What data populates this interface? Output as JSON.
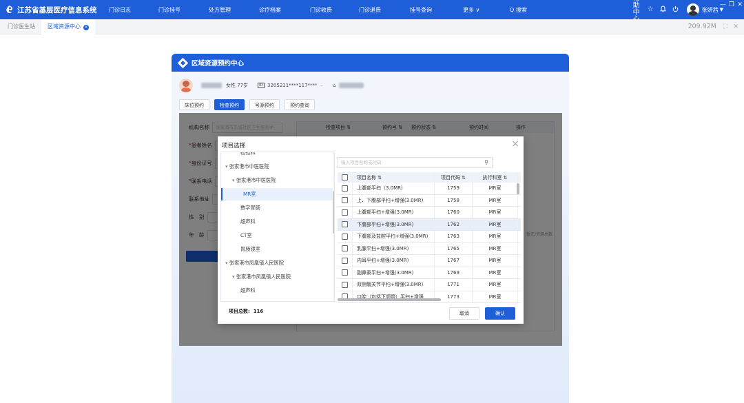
{
  "app": {
    "logo_text": "江苏省基层医疗信息系统"
  },
  "nav": [
    {
      "label": "门诊日志"
    },
    {
      "label": "门诊挂号"
    },
    {
      "label": "处方管理"
    },
    {
      "label": "诊疗档案"
    },
    {
      "label": "门诊收费"
    },
    {
      "label": "门诊退费"
    },
    {
      "label": "挂号查询"
    },
    {
      "label": "更多 ∨"
    },
    {
      "label": "Q 搜索"
    }
  ],
  "topright": {
    "help": "帮助中心",
    "user": "张妍茜"
  },
  "tabs": [
    {
      "label": "门诊医生站"
    },
    {
      "label": "区域资源中心"
    }
  ],
  "memory": "209.92M",
  "panel": {
    "title": "区域资源预约中心"
  },
  "patient": {
    "gender_age": "女性 77岁",
    "id_tag": "ID",
    "id_number": "3205211****117****"
  },
  "panel_tabs": [
    {
      "label": "床位预约"
    },
    {
      "label": "检查预约"
    },
    {
      "label": "号源预约"
    },
    {
      "label": "预约查询"
    }
  ],
  "form": {
    "org_label": "机构名称",
    "org_value": "张家港市东城社区卫生服务中",
    "name_label": "患者姓名",
    "idcard_label": "身份证号",
    "phone_label": "联系电话",
    "addr_label": "联系地址",
    "gender_label": "性　别",
    "age_label": "年　龄"
  },
  "rtable": {
    "cols": [
      "检查项目 ⇅",
      "预约号 ⇅",
      "预约状态 ⇅",
      "预约时间",
      "操作"
    ],
    "side_text": "暂无/资源总数"
  },
  "modal": {
    "title": "项目选择",
    "tree": [
      "检验科",
      "张家港市中医医院",
      "张家港市中医医院",
      "MR室",
      "数字胃肠",
      "超声科",
      "CT室",
      "胃肠镜室",
      "张家港市凤凰镇人民医院",
      "张家港市凤凰镇人民医院",
      "超声科"
    ],
    "search_placeholder": "输入项目名称或代码",
    "headers": {
      "name": "项目名称 ⇅",
      "code": "项目代码 ⇅",
      "dept": "执行科室 ⇅"
    },
    "rows": [
      {
        "name": "上腹部平扫（3.0MR)",
        "code": "1759",
        "dept": "MR室"
      },
      {
        "name": "上、下腹部平扫+增强(3.0MR)",
        "code": "1758",
        "dept": "MR室"
      },
      {
        "name": "上腹部平扫+增强(3.0MR)",
        "code": "1760",
        "dept": "MR室"
      },
      {
        "name": "下腹部平扫+增强(3.0MR)",
        "code": "1762",
        "dept": "MR室"
      },
      {
        "name": "下腹部及盆腔平扫+增强(3.0MR)",
        "code": "1763",
        "dept": "MR室"
      },
      {
        "name": "乳腺平扫+增强(3.0MR)",
        "code": "1765",
        "dept": "MR室"
      },
      {
        "name": "内耳平扫+增强(3.0MR)",
        "code": "1767",
        "dept": "MR室"
      },
      {
        "name": "副鼻窦平扫+增强(3.0MR)",
        "code": "1769",
        "dept": "MR室"
      },
      {
        "name": "双侧髋关节平扫+增强(3.0MR)",
        "code": "1771",
        "dept": "MR室"
      },
      {
        "name": "口腔（包括下颌骨）平扫+增强",
        "code": "1773",
        "dept": "MR室"
      }
    ],
    "total_label": "项目总数:",
    "total_value": "116",
    "cancel": "取消",
    "ok": "确认"
  },
  "colors": {
    "primary": "#1e5fd9"
  }
}
